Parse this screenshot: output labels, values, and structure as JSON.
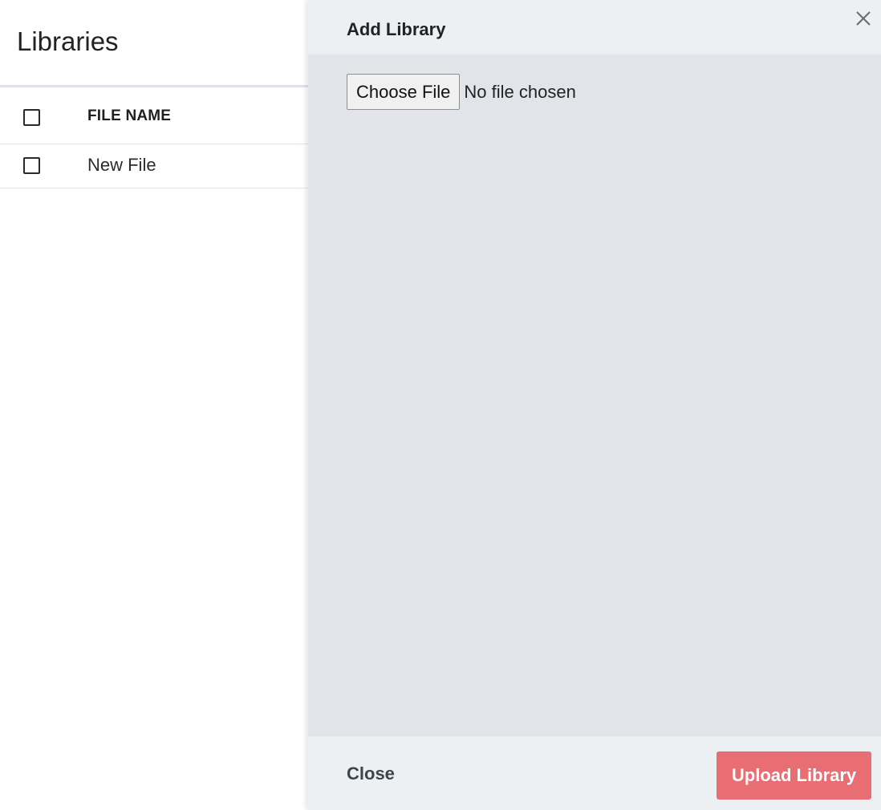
{
  "page": {
    "title": "Libraries"
  },
  "table": {
    "columns": [
      "FILE NAME"
    ],
    "rows": [
      {
        "name": "New File"
      }
    ]
  },
  "panel": {
    "title": "Add Library",
    "close_icon": "close-icon",
    "file_input": {
      "button_label": "Choose File",
      "status": "No file chosen"
    },
    "footer": {
      "close_label": "Close",
      "upload_label": "Upload Library"
    }
  },
  "colors": {
    "panel_bg": "#e1e5e9",
    "panel_header_bg": "#edf0f2",
    "upload_button": "#e8686e"
  }
}
